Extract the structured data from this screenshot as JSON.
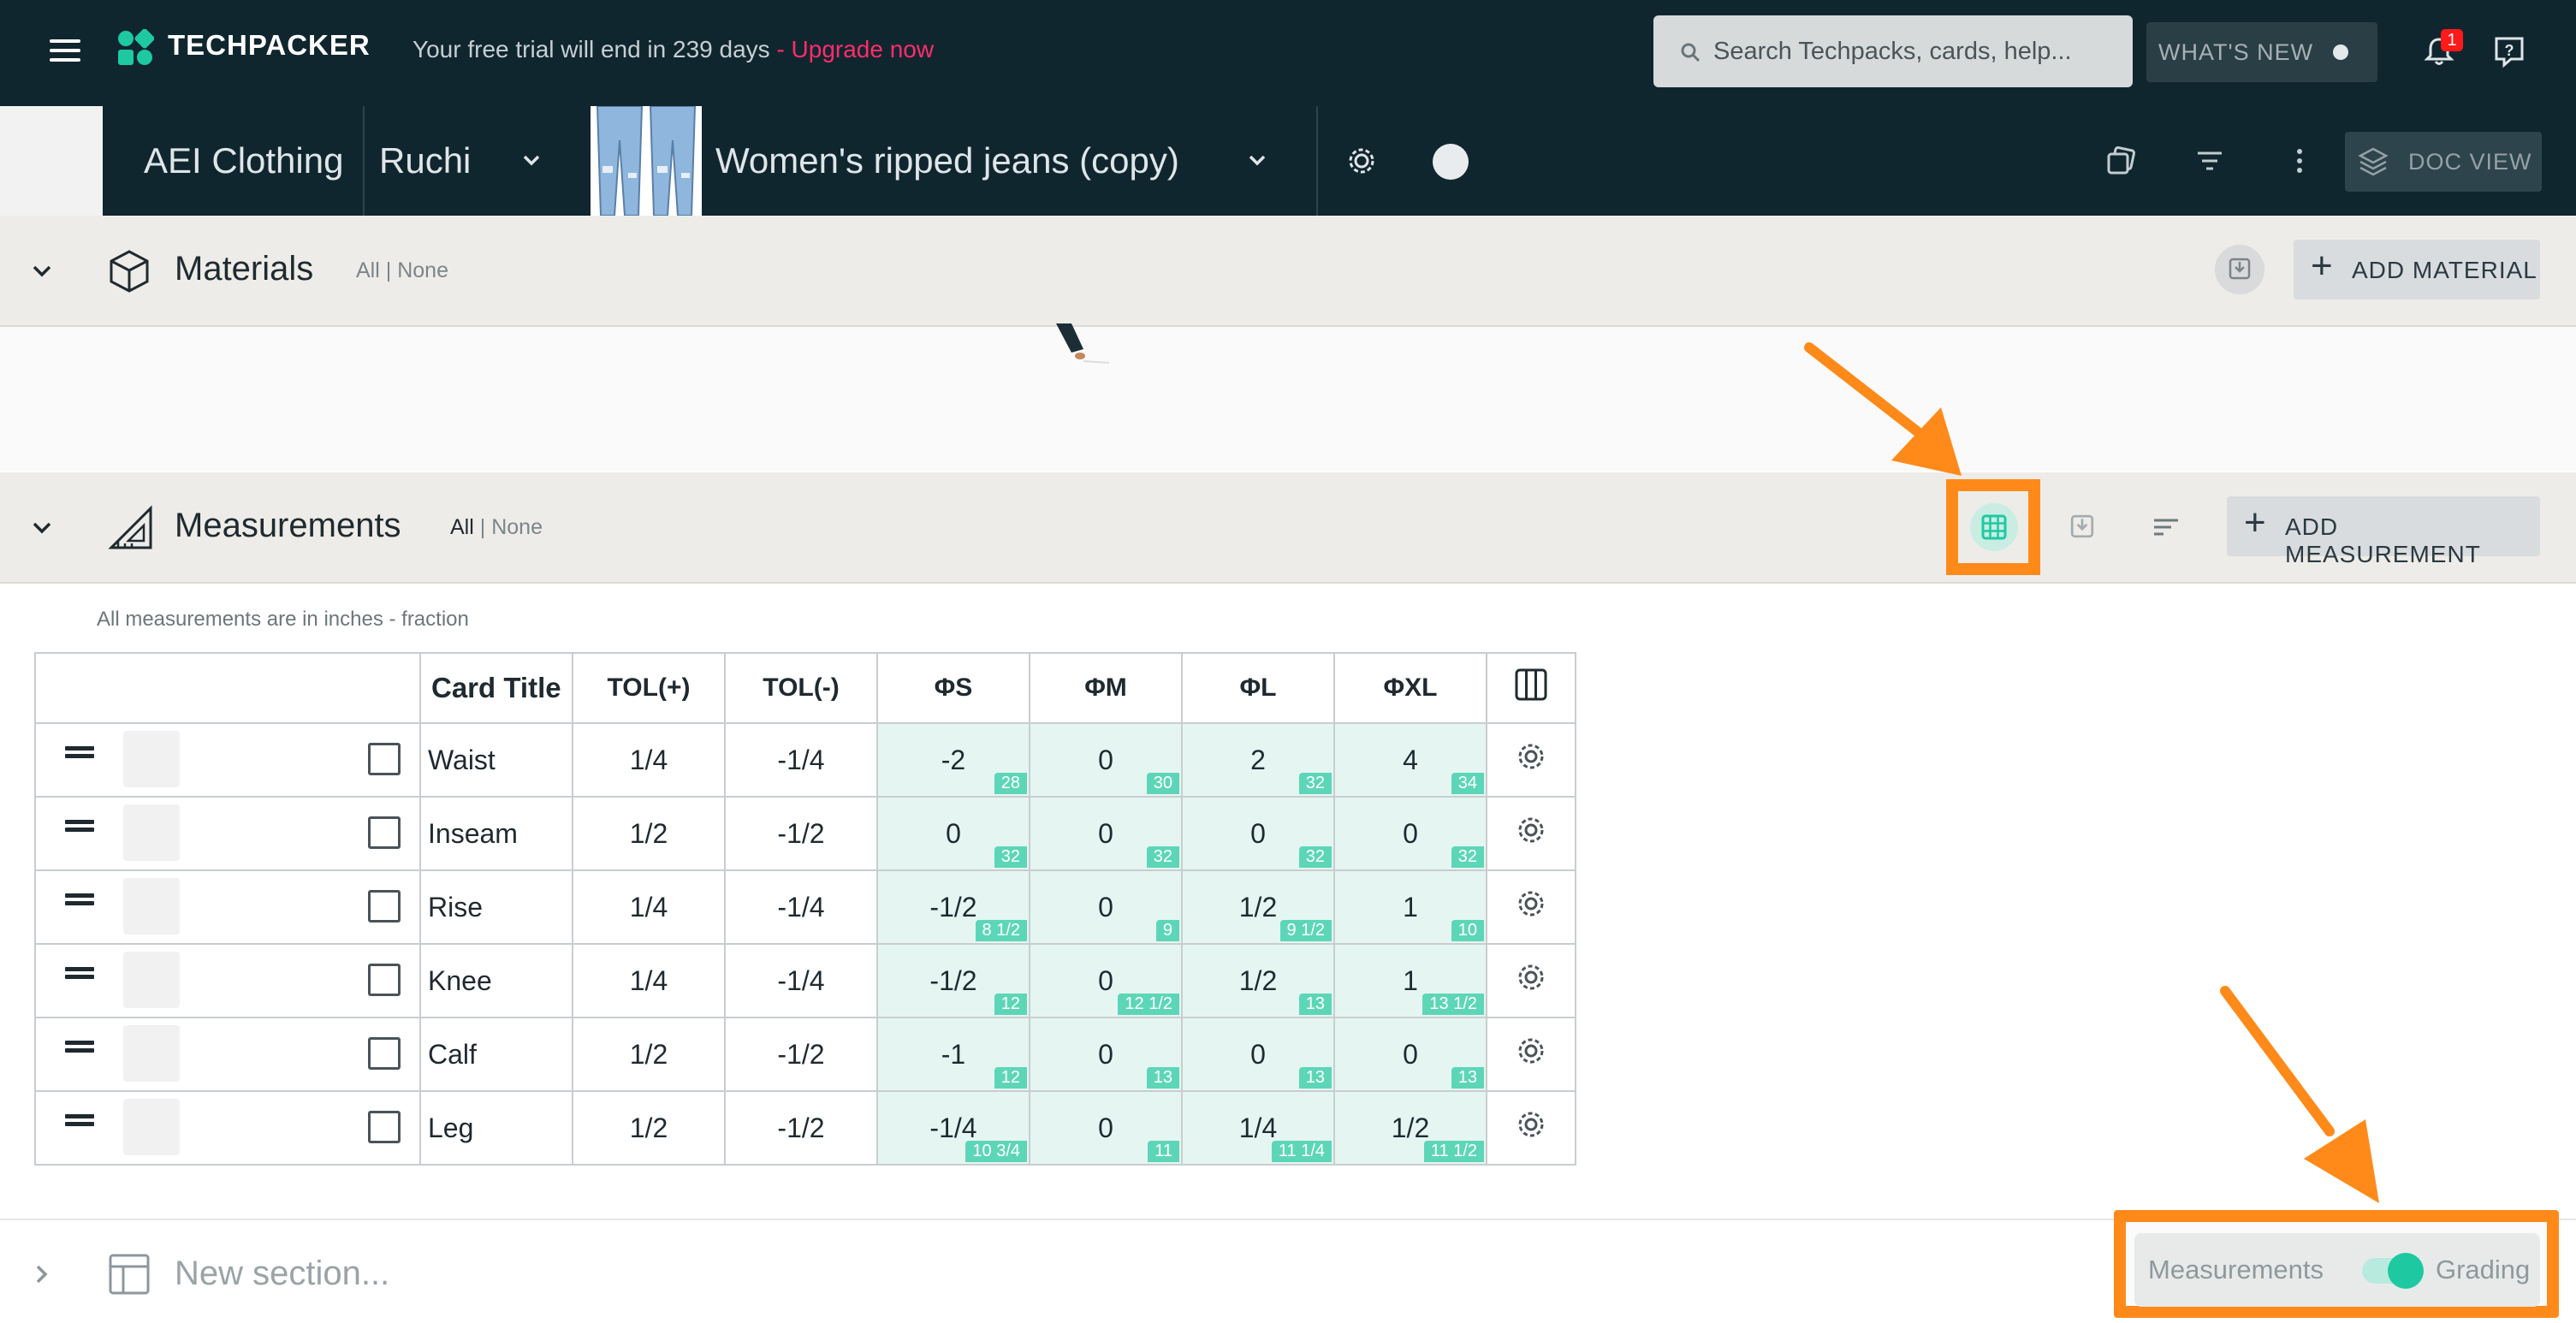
{
  "topbar": {
    "brand": "TECHPACKER",
    "trial_text": "Your free trial will end in 239 days",
    "upgrade_text": "- Upgrade now",
    "search_placeholder": "Search Techpacks, cards, help...",
    "whats_new": "WHAT'S NEW",
    "notification_count": "1"
  },
  "techpack": {
    "company": "AEI Clothing",
    "owner": "Ruchi",
    "name": "Women's ripped jeans (copy)",
    "doc_view": "DOC VIEW"
  },
  "materials": {
    "title": "Materials",
    "filter_all": "All",
    "filter_sep": "|",
    "filter_none": "None",
    "add_button": "ADD MATERIAL"
  },
  "measurements": {
    "title": "Measurements",
    "filter_all": "All",
    "filter_sep": "|",
    "filter_none": "None",
    "add_button": "ADD MEASUREMENT",
    "note": "All measurements are in inches - fraction",
    "columns": [
      "Card Title",
      "TOL(+)",
      "TOL(-)",
      "ΦS",
      "ΦM",
      "ΦL",
      "ΦXL"
    ],
    "rows": [
      {
        "title": "Waist",
        "tol_plus": "1/4",
        "tol_minus": "-1/4",
        "sizes": [
          {
            "v": "-2",
            "b": "28"
          },
          {
            "v": "0",
            "b": "30"
          },
          {
            "v": "2",
            "b": "32"
          },
          {
            "v": "4",
            "b": "34"
          }
        ]
      },
      {
        "title": "Inseam",
        "tol_plus": "1/2",
        "tol_minus": "-1/2",
        "sizes": [
          {
            "v": "0",
            "b": "32"
          },
          {
            "v": "0",
            "b": "32"
          },
          {
            "v": "0",
            "b": "32"
          },
          {
            "v": "0",
            "b": "32"
          }
        ]
      },
      {
        "title": "Rise",
        "tol_plus": "1/4",
        "tol_minus": "-1/4",
        "sizes": [
          {
            "v": "-1/2",
            "b": "8 1/2"
          },
          {
            "v": "0",
            "b": "9"
          },
          {
            "v": "1/2",
            "b": "9 1/2"
          },
          {
            "v": "1",
            "b": "10"
          }
        ]
      },
      {
        "title": "Knee",
        "tol_plus": "1/4",
        "tol_minus": "-1/4",
        "sizes": [
          {
            "v": "-1/2",
            "b": "12"
          },
          {
            "v": "0",
            "b": "12 1/2"
          },
          {
            "v": "1/2",
            "b": "13"
          },
          {
            "v": "1",
            "b": "13 1/2"
          }
        ]
      },
      {
        "title": "Calf",
        "tol_plus": "1/2",
        "tol_minus": "-1/2",
        "sizes": [
          {
            "v": "-1",
            "b": "12"
          },
          {
            "v": "0",
            "b": "13"
          },
          {
            "v": "0",
            "b": "13"
          },
          {
            "v": "0",
            "b": "13"
          }
        ]
      },
      {
        "title": "Leg",
        "tol_plus": "1/2",
        "tol_minus": "-1/2",
        "sizes": [
          {
            "v": "-1/4",
            "b": "10 3/4"
          },
          {
            "v": "0",
            "b": "11"
          },
          {
            "v": "1/4",
            "b": "11 1/4"
          },
          {
            "v": "1/2",
            "b": "11 1/2"
          }
        ]
      }
    ]
  },
  "new_section": {
    "placeholder": "New section..."
  },
  "view_toggle": {
    "left_label": "Measurements",
    "right_label": "Grading",
    "state": "Grading"
  },
  "colors": {
    "header_bg": "#10262f",
    "accent_green": "#1ec9a2",
    "highlight_orange": "#ff8a1a",
    "upgrade_pink": "#ff2d6b"
  }
}
